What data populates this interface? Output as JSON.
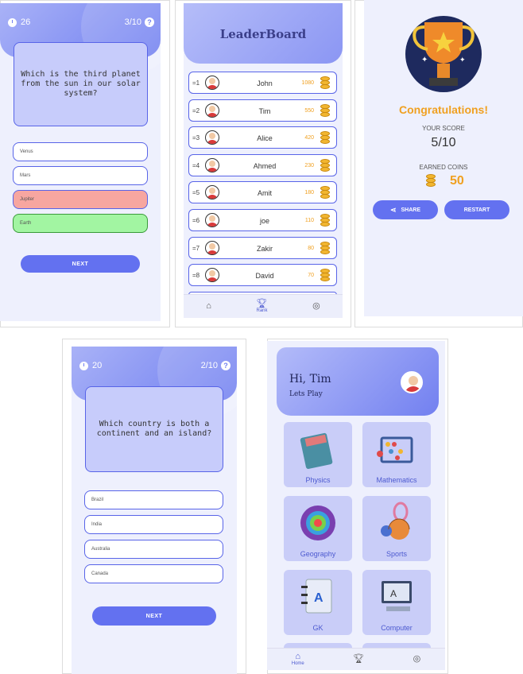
{
  "quiz1": {
    "timer": "26",
    "progress": "3/10",
    "help": "?",
    "question": "Which is the third planet from the sun in our solar system?",
    "options": [
      "Venus",
      "Mars",
      "Jupiter",
      "Earth"
    ],
    "next": "NEXT"
  },
  "leaderboard": {
    "title": "LeaderBoard",
    "rows": [
      {
        "rank": "=1",
        "name": "John",
        "score": "1080"
      },
      {
        "rank": "=2",
        "name": "Tim",
        "score": "550"
      },
      {
        "rank": "=3",
        "name": "Alice",
        "score": "420"
      },
      {
        "rank": "=4",
        "name": "Ahmed",
        "score": "230"
      },
      {
        "rank": "=5",
        "name": "Amit",
        "score": "180"
      },
      {
        "rank": "=6",
        "name": "joe",
        "score": "110"
      },
      {
        "rank": "=7",
        "name": "Zakir",
        "score": "80"
      },
      {
        "rank": "=8",
        "name": "David",
        "score": "70"
      }
    ],
    "nav_rank": "Rank"
  },
  "result": {
    "congrats": "Congratulations!",
    "score_label": "YOUR SCORE",
    "score": "5/10",
    "coins_label": "EARNED COINS",
    "coins": "50",
    "share": "SHARE",
    "restart": "RESTART"
  },
  "quiz2": {
    "timer": "20",
    "progress": "2/10",
    "help": "?",
    "question": "Which country is both a continent and an island?",
    "options": [
      "Brazil",
      "India",
      "Australia",
      "Canada"
    ],
    "next": "NEXT"
  },
  "home": {
    "greeting": "Hi, Tim",
    "subtitle": "Lets Play",
    "categories": [
      "Physics",
      "Mathematics",
      "Geography",
      "Sports",
      "GK",
      "Computer"
    ],
    "nav_home": "Home"
  },
  "colors": {
    "accent": "#6371f0",
    "coin": "#f2b630",
    "wrong": "#f7a6a0",
    "right": "#a2f5a2"
  }
}
